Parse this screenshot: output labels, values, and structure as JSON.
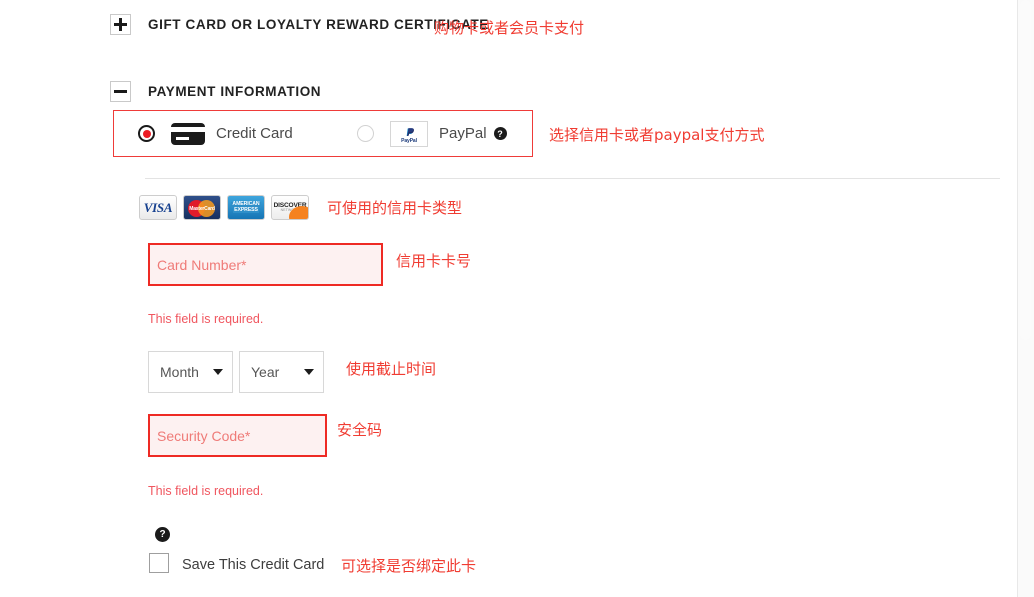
{
  "sections": {
    "gift_card": {
      "toggle": "+",
      "title": "GIFT CARD OR LOYALTY REWARD CERTIFICATE",
      "annotation": "购物卡或者会员卡支付"
    },
    "payment_information": {
      "toggle": "−",
      "title": "PAYMENT INFORMATION",
      "annotation": "选择信用卡或者paypal支付方式"
    }
  },
  "payment_methods": {
    "credit_card": {
      "label": "Credit Card",
      "selected": true,
      "icon": "credit-card-icon"
    },
    "paypal": {
      "label": "PayPal",
      "selected": false,
      "icon": "paypal-logo-icon",
      "help": "?",
      "logo_word": "PayPal"
    }
  },
  "accepted_cards": {
    "annotation": "可使用的信用卡类型",
    "logos": [
      {
        "name": "visa",
        "text": "VISA"
      },
      {
        "name": "mastercard",
        "text": "MasterCard"
      },
      {
        "name": "amex",
        "line1": "AMERICAN",
        "line2": "EXPRESS"
      },
      {
        "name": "discover",
        "line1": "DISCOVER",
        "line2": "NETWORK"
      }
    ]
  },
  "form": {
    "card_number": {
      "placeholder": "Card Number*",
      "value": "",
      "error": "This field is required.",
      "annotation": "信用卡卡号"
    },
    "expiry": {
      "month": "Month",
      "year": "Year",
      "annotation": "使用截止时间"
    },
    "security_code": {
      "placeholder": "Security Code*",
      "value": "",
      "error": "This field is required.",
      "annotation": "安全码"
    },
    "save_card": {
      "label": "Save This Credit Card",
      "checked": false,
      "help": "?",
      "annotation": "可选择是否绑定此卡"
    }
  },
  "colors": {
    "error_red": "#ee2a24",
    "annotation_red": "#f03c32",
    "error_text": "#f0565f",
    "radio_dot": "#ec1c24"
  }
}
